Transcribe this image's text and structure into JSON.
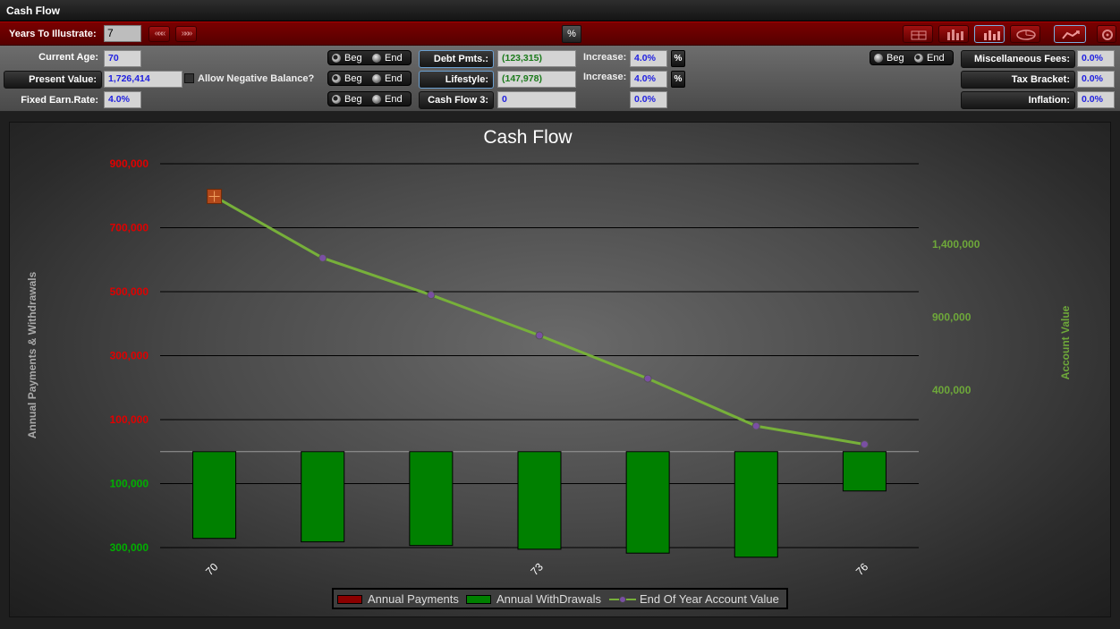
{
  "window": {
    "title": "Cash Flow"
  },
  "toolbar": {
    "years_label": "Years To Illustrate:",
    "years_value": "7",
    "prev_label": "«««",
    "next_label": "»»»",
    "percent_label": "%"
  },
  "inputs": {
    "current_age_label": "Current Age:",
    "current_age": "70",
    "present_value_label": "Present Value:",
    "present_value": "1,726,414",
    "allow_negative_label": "Allow Negative Balance?",
    "fixed_rate_label": "Fixed Earn.Rate:",
    "fixed_rate": "4.0%",
    "beg_label": "Beg",
    "end_label": "End",
    "debt_label": "Debt Pmts.:",
    "debt_value": "(123,315)",
    "lifestyle_label": "Lifestyle:",
    "lifestyle_value": "(147,978)",
    "cf3_label": "Cash Flow 3:",
    "cf3_value": "0",
    "increase_label": "Increase:",
    "increase1": "4.0%",
    "increase2": "4.0%",
    "increase3": "0.0%",
    "pct_btn": "%",
    "misc_label": "Miscellaneous Fees:",
    "misc_value": "0.0%",
    "tax_label": "Tax Bracket:",
    "tax_value": "0.0%",
    "inflation_label": "Inflation:",
    "inflation_value": "0.0%"
  },
  "colors": {
    "payments": "#8b0000",
    "withdrawals": "#008000",
    "account_line": "#77b03a",
    "marker": "#7a4fa3",
    "left_axis_pos": "#e00000",
    "left_axis_neg": "#00b000",
    "right_axis": "#6ea83a"
  },
  "chart_data": {
    "type": "bar",
    "title": "Cash Flow",
    "ylabel": "Annual Payments & Withdrawals",
    "y2label": "Account Value",
    "x": [
      70,
      71,
      72,
      73,
      74,
      75,
      76
    ],
    "x_tick_labels": [
      "70",
      "73",
      "76"
    ],
    "ylim": [
      -300000,
      900000
    ],
    "y_tick_labels": [
      "900,000",
      "700,000",
      "500,000",
      "300,000",
      "100,000",
      "100,000",
      "300,000"
    ],
    "y_tick_values": [
      900000,
      700000,
      500000,
      300000,
      100000,
      -100000,
      -300000
    ],
    "y2_tick_labels": [
      "1,400,000",
      "900,000",
      "400,000"
    ],
    "y2_tick_values": [
      1400000,
      900000,
      400000
    ],
    "series": [
      {
        "name": "Annual Payments",
        "type": "bar",
        "values": [
          0,
          0,
          0,
          0,
          0,
          0,
          0
        ]
      },
      {
        "name": "Annual WithDrawals",
        "type": "bar",
        "values": [
          -271293,
          -282145,
          -293431,
          -305168,
          -317375,
          -330070,
          -123000
        ]
      },
      {
        "name": "End Of Year Account Value",
        "type": "line",
        "axis": "y2",
        "values": [
          1726414,
          1305000,
          1052000,
          775000,
          480000,
          155000,
          30000
        ]
      }
    ],
    "legend_position": "bottom",
    "grid": true
  }
}
